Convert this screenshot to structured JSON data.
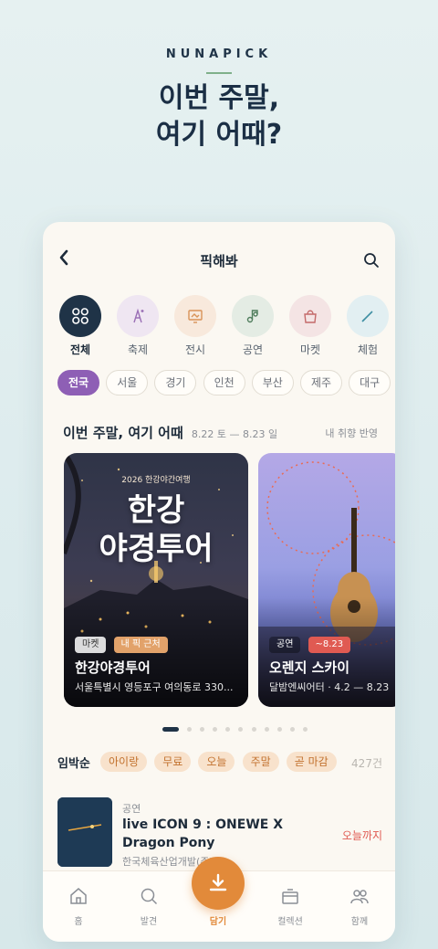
{
  "hero": {
    "brand": "NUNAPICK",
    "headline_line1": "이번 주말,",
    "headline_line2": "여기 어때?"
  },
  "topbar": {
    "back_label": "‹",
    "title": "픽해봐",
    "search_icon": "search-icon"
  },
  "categories": [
    {
      "label": "전체",
      "icon": "grid-icon",
      "active": true,
      "color": "#1f3347"
    },
    {
      "label": "축제",
      "icon": "sparkle-icon",
      "color": "#efe6f2"
    },
    {
      "label": "전시",
      "icon": "frame-icon",
      "color": "#f8e9dc"
    },
    {
      "label": "공연",
      "icon": "music-note-icon",
      "color": "#e4ece4"
    },
    {
      "label": "마켓",
      "icon": "bag-icon",
      "color": "#f4e4e4"
    },
    {
      "label": "체험",
      "icon": "brush-icon",
      "color": "#e2eff2"
    }
  ],
  "regions": [
    "전국",
    "서울",
    "경기",
    "인천",
    "부산",
    "제주",
    "대구"
  ],
  "section": {
    "title": "이번 주말, 여기 어때",
    "date_range": "8.22 토 — 8.23 일",
    "right_note": "내 취향 반영"
  },
  "featured": [
    {
      "poster_sub": "2026 한강야간여행",
      "poster_title_1": "한강",
      "poster_title_2": "야경투어",
      "tags": [
        "마켓",
        "내 픽 근처"
      ],
      "name": "한강야경투어",
      "sub": "서울특별시 영등포구 여의동로 330..."
    },
    {
      "tags": [
        "공연",
        "~8.23"
      ],
      "name": "오렌지 스카이",
      "sub": "달밤엔씨어터 · 4.2 — 8.23"
    }
  ],
  "pager": {
    "count": 11,
    "active": 0
  },
  "filters": {
    "label": "임박순",
    "chips": [
      "아이랑",
      "무료",
      "오늘",
      "주말",
      "곧 마감"
    ],
    "count": "427건"
  },
  "list": [
    {
      "category": "공연",
      "title": "live ICON 9 : ONEWE X Dragon Pony",
      "org": "한국체육산업개발(주)...",
      "when": "오늘까지"
    }
  ],
  "tabs": {
    "home": "홈",
    "discover": "발견",
    "save": "담기",
    "collection": "컬렉션",
    "together": "함께"
  }
}
